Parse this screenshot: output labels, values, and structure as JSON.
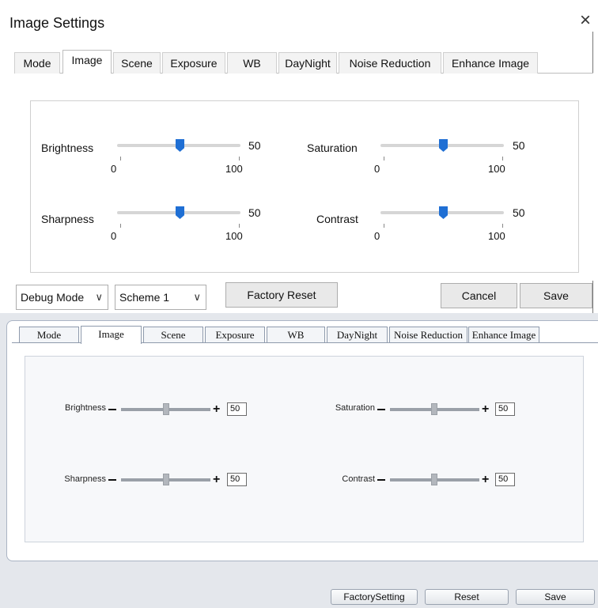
{
  "dialog": {
    "title": "Image Settings",
    "close_glyph": "×",
    "tabs": [
      {
        "label": "Mode",
        "active": false
      },
      {
        "label": "Image",
        "active": true
      },
      {
        "label": "Scene",
        "active": false
      },
      {
        "label": "Exposure",
        "active": false
      },
      {
        "label": "WB",
        "active": false
      },
      {
        "label": "DayNight",
        "active": false
      },
      {
        "label": "Noise Reduction",
        "active": false
      },
      {
        "label": "Enhance Image",
        "active": false
      }
    ],
    "sliders": [
      {
        "label": "Brightness",
        "value": "50",
        "min": "0",
        "max": "100"
      },
      {
        "label": "Saturation",
        "value": "50",
        "min": "0",
        "max": "100"
      },
      {
        "label": "Sharpness",
        "value": "50",
        "min": "0",
        "max": "100"
      },
      {
        "label": "Contrast",
        "value": "50",
        "min": "0",
        "max": "100"
      }
    ],
    "debug_mode": "Debug Mode",
    "scheme": "Scheme 1",
    "factory_reset": "Factory Reset",
    "cancel": "Cancel",
    "save": "Save",
    "chevron": "∨"
  },
  "web": {
    "tabs": [
      {
        "label": "Mode",
        "active": false
      },
      {
        "label": "Image",
        "active": true
      },
      {
        "label": "Scene",
        "active": false
      },
      {
        "label": "Exposure",
        "active": false
      },
      {
        "label": "WB",
        "active": false
      },
      {
        "label": "DayNight",
        "active": false
      },
      {
        "label": "Noise Reduction",
        "active": false
      },
      {
        "label": "Enhance Image",
        "active": false
      }
    ],
    "sliders": [
      {
        "label": "Brightness",
        "value": "50"
      },
      {
        "label": "Saturation",
        "value": "50"
      },
      {
        "label": "Sharpness",
        "value": "50"
      },
      {
        "label": "Contrast",
        "value": "50"
      }
    ],
    "plus_glyph": "+",
    "factory_setting": "FactorySetting",
    "reset": "Reset",
    "save": "Save"
  },
  "colors": {
    "accent_thumb": "#1f6fd4",
    "panel_bg": "#e4e7ec"
  }
}
